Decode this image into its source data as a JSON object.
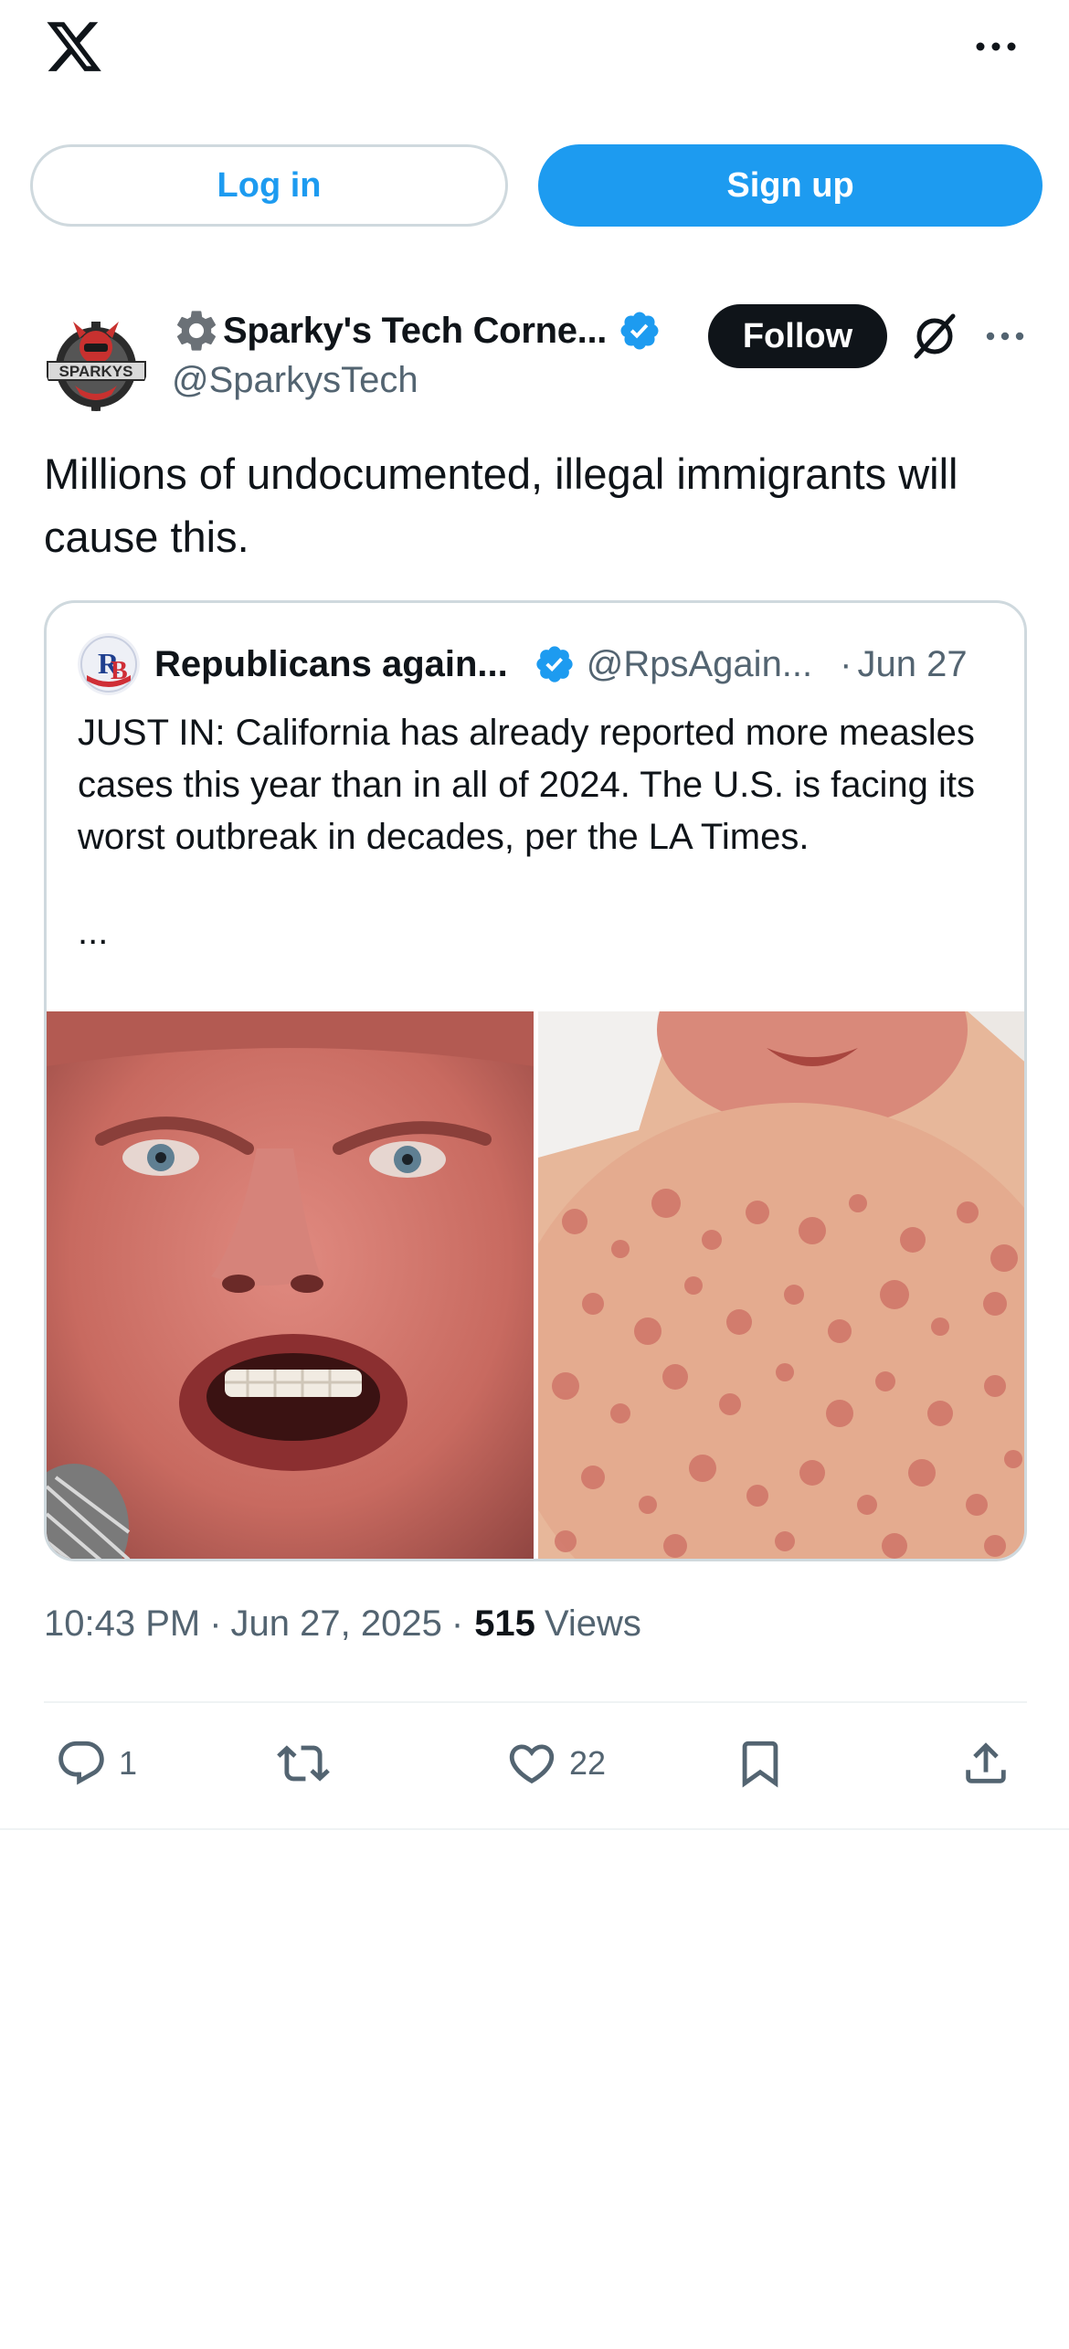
{
  "topbar": {
    "logo_icon": "x-logo-icon",
    "more_icon": "more-horizontal-icon"
  },
  "auth": {
    "login_label": "Log in",
    "signup_label": "Sign up"
  },
  "post": {
    "author": {
      "display_name": "Sparky's Tech Corne...",
      "handle": "@SparkysTech",
      "verified": true
    },
    "follow_label": "Follow",
    "text": "Millions of undocumented, illegal immigrants will cause this.",
    "quote": {
      "author_name": "Republicans again...",
      "author_handle": "@RpsAgain...",
      "separator": "·",
      "date": "Jun 27",
      "text": "JUST IN: California has already reported more measles cases this year than in all of 2024. The U.S. is facing its worst outbreak in decades, per the LA Times.",
      "ellipsis": "..."
    },
    "meta": {
      "time": "10:43 PM",
      "separator1": "·",
      "date": "Jun 27, 2025",
      "separator2": "·",
      "views_count": "515",
      "views_label": "Views"
    },
    "actions": {
      "reply_count": "1",
      "repost_count": "",
      "like_count": "22"
    }
  },
  "colors": {
    "accent": "#1d9bf0",
    "text_primary": "#0f1419",
    "text_secondary": "#536471",
    "border": "#cfd9de"
  }
}
